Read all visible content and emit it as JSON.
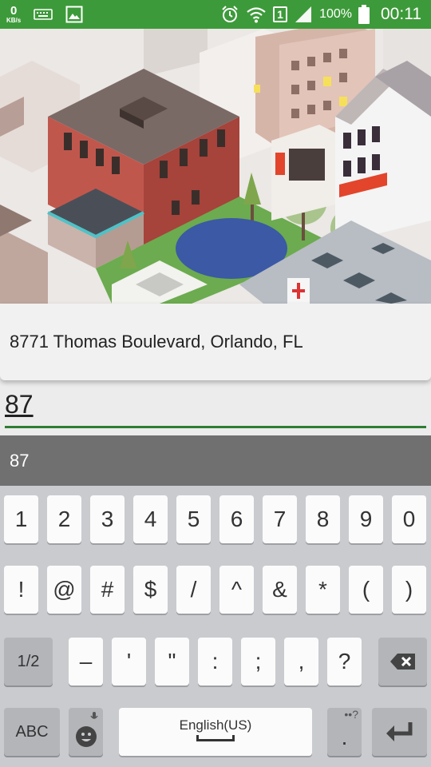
{
  "status_bar": {
    "net_speed": "0",
    "net_unit": "KB/s",
    "sim_slot": "1",
    "battery_percent": "100%",
    "time": "00:11",
    "icons": [
      "keyboard-icon",
      "image-icon",
      "alarm-icon",
      "wifi-icon",
      "sim-icon",
      "signal-icon",
      "battery-icon"
    ]
  },
  "suggestion": {
    "address": "8771 Thomas Boulevard, Orlando, FL"
  },
  "input": {
    "value": "87"
  },
  "keyboard": {
    "suggestion": "87",
    "row1": [
      "1",
      "2",
      "3",
      "4",
      "5",
      "6",
      "7",
      "8",
      "9",
      "0"
    ],
    "row2": [
      "!",
      "@",
      "#",
      "$",
      "/",
      "^",
      "&",
      "*",
      "(",
      ")"
    ],
    "row3": [
      "1/2",
      "–",
      "'",
      "\"",
      ":",
      ";",
      ",",
      "?"
    ],
    "abc_label": "ABC",
    "space_label": "English(US)",
    "period": ".",
    "period_hint": "••?"
  },
  "colors": {
    "status_bar": "#3d9a3a",
    "input_underline": "#2e7d32",
    "suggestion_strip": "#707070"
  }
}
